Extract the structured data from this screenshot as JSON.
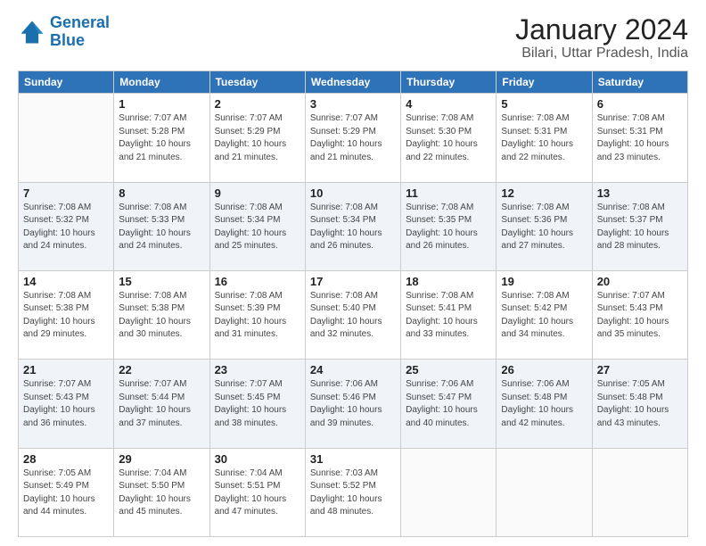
{
  "logo": {
    "line1": "General",
    "line2": "Blue"
  },
  "title": "January 2024",
  "subtitle": "Bilari, Uttar Pradesh, India",
  "header_days": [
    "Sunday",
    "Monday",
    "Tuesday",
    "Wednesday",
    "Thursday",
    "Friday",
    "Saturday"
  ],
  "weeks": [
    [
      {
        "day": "",
        "info": ""
      },
      {
        "day": "1",
        "info": "Sunrise: 7:07 AM\nSunset: 5:28 PM\nDaylight: 10 hours\nand 21 minutes."
      },
      {
        "day": "2",
        "info": "Sunrise: 7:07 AM\nSunset: 5:29 PM\nDaylight: 10 hours\nand 21 minutes."
      },
      {
        "day": "3",
        "info": "Sunrise: 7:07 AM\nSunset: 5:29 PM\nDaylight: 10 hours\nand 21 minutes."
      },
      {
        "day": "4",
        "info": "Sunrise: 7:08 AM\nSunset: 5:30 PM\nDaylight: 10 hours\nand 22 minutes."
      },
      {
        "day": "5",
        "info": "Sunrise: 7:08 AM\nSunset: 5:31 PM\nDaylight: 10 hours\nand 22 minutes."
      },
      {
        "day": "6",
        "info": "Sunrise: 7:08 AM\nSunset: 5:31 PM\nDaylight: 10 hours\nand 23 minutes."
      }
    ],
    [
      {
        "day": "7",
        "info": "Sunrise: 7:08 AM\nSunset: 5:32 PM\nDaylight: 10 hours\nand 24 minutes."
      },
      {
        "day": "8",
        "info": "Sunrise: 7:08 AM\nSunset: 5:33 PM\nDaylight: 10 hours\nand 24 minutes."
      },
      {
        "day": "9",
        "info": "Sunrise: 7:08 AM\nSunset: 5:34 PM\nDaylight: 10 hours\nand 25 minutes."
      },
      {
        "day": "10",
        "info": "Sunrise: 7:08 AM\nSunset: 5:34 PM\nDaylight: 10 hours\nand 26 minutes."
      },
      {
        "day": "11",
        "info": "Sunrise: 7:08 AM\nSunset: 5:35 PM\nDaylight: 10 hours\nand 26 minutes."
      },
      {
        "day": "12",
        "info": "Sunrise: 7:08 AM\nSunset: 5:36 PM\nDaylight: 10 hours\nand 27 minutes."
      },
      {
        "day": "13",
        "info": "Sunrise: 7:08 AM\nSunset: 5:37 PM\nDaylight: 10 hours\nand 28 minutes."
      }
    ],
    [
      {
        "day": "14",
        "info": "Sunrise: 7:08 AM\nSunset: 5:38 PM\nDaylight: 10 hours\nand 29 minutes."
      },
      {
        "day": "15",
        "info": "Sunrise: 7:08 AM\nSunset: 5:38 PM\nDaylight: 10 hours\nand 30 minutes."
      },
      {
        "day": "16",
        "info": "Sunrise: 7:08 AM\nSunset: 5:39 PM\nDaylight: 10 hours\nand 31 minutes."
      },
      {
        "day": "17",
        "info": "Sunrise: 7:08 AM\nSunset: 5:40 PM\nDaylight: 10 hours\nand 32 minutes."
      },
      {
        "day": "18",
        "info": "Sunrise: 7:08 AM\nSunset: 5:41 PM\nDaylight: 10 hours\nand 33 minutes."
      },
      {
        "day": "19",
        "info": "Sunrise: 7:08 AM\nSunset: 5:42 PM\nDaylight: 10 hours\nand 34 minutes."
      },
      {
        "day": "20",
        "info": "Sunrise: 7:07 AM\nSunset: 5:43 PM\nDaylight: 10 hours\nand 35 minutes."
      }
    ],
    [
      {
        "day": "21",
        "info": "Sunrise: 7:07 AM\nSunset: 5:43 PM\nDaylight: 10 hours\nand 36 minutes."
      },
      {
        "day": "22",
        "info": "Sunrise: 7:07 AM\nSunset: 5:44 PM\nDaylight: 10 hours\nand 37 minutes."
      },
      {
        "day": "23",
        "info": "Sunrise: 7:07 AM\nSunset: 5:45 PM\nDaylight: 10 hours\nand 38 minutes."
      },
      {
        "day": "24",
        "info": "Sunrise: 7:06 AM\nSunset: 5:46 PM\nDaylight: 10 hours\nand 39 minutes."
      },
      {
        "day": "25",
        "info": "Sunrise: 7:06 AM\nSunset: 5:47 PM\nDaylight: 10 hours\nand 40 minutes."
      },
      {
        "day": "26",
        "info": "Sunrise: 7:06 AM\nSunset: 5:48 PM\nDaylight: 10 hours\nand 42 minutes."
      },
      {
        "day": "27",
        "info": "Sunrise: 7:05 AM\nSunset: 5:48 PM\nDaylight: 10 hours\nand 43 minutes."
      }
    ],
    [
      {
        "day": "28",
        "info": "Sunrise: 7:05 AM\nSunset: 5:49 PM\nDaylight: 10 hours\nand 44 minutes."
      },
      {
        "day": "29",
        "info": "Sunrise: 7:04 AM\nSunset: 5:50 PM\nDaylight: 10 hours\nand 45 minutes."
      },
      {
        "day": "30",
        "info": "Sunrise: 7:04 AM\nSunset: 5:51 PM\nDaylight: 10 hours\nand 47 minutes."
      },
      {
        "day": "31",
        "info": "Sunrise: 7:03 AM\nSunset: 5:52 PM\nDaylight: 10 hours\nand 48 minutes."
      },
      {
        "day": "",
        "info": ""
      },
      {
        "day": "",
        "info": ""
      },
      {
        "day": "",
        "info": ""
      }
    ]
  ]
}
